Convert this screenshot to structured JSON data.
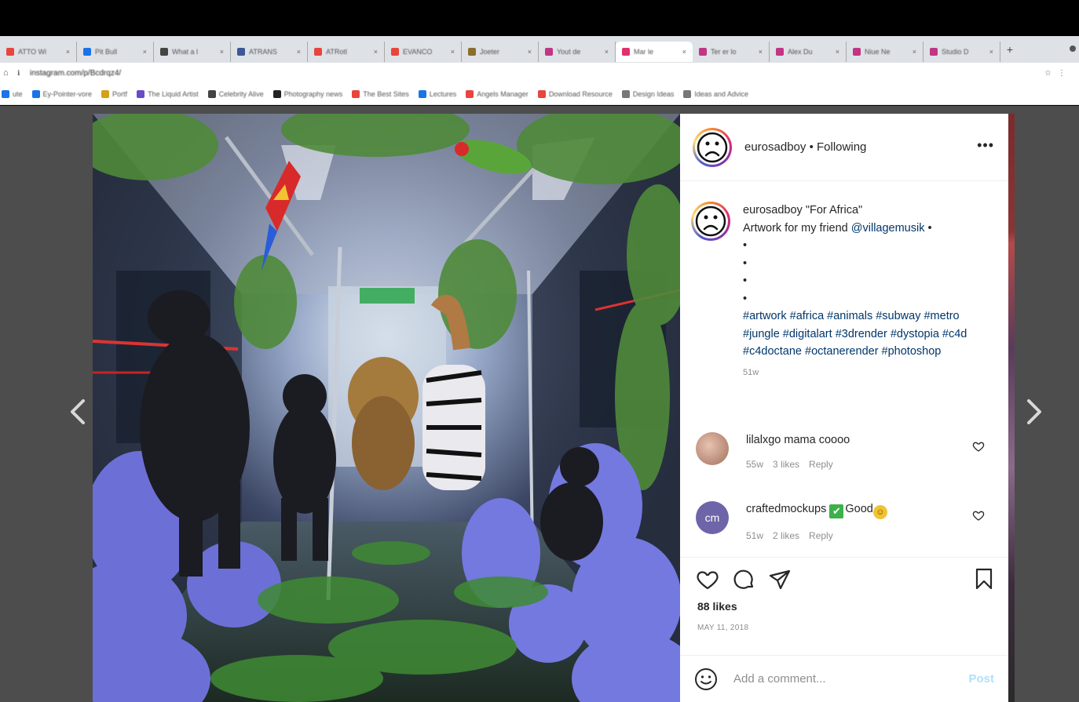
{
  "browser": {
    "tabs": [
      {
        "title": "ATTO Wi",
        "color": "#e8453c"
      },
      {
        "title": "Pit Bull",
        "color": "#1a73e8"
      },
      {
        "title": "What a l",
        "color": "#444444"
      },
      {
        "title": "ATRANS",
        "color": "#3b5998"
      },
      {
        "title": "ATRotl",
        "color": "#e8453c"
      },
      {
        "title": "EVANCO",
        "color": "#e8453c"
      },
      {
        "title": "Joeter",
        "color": "#8b6d2e"
      },
      {
        "title": "Yout de",
        "color": "#c13584"
      },
      {
        "title": "Mar le",
        "color": "#e1306c",
        "active": true
      },
      {
        "title": "Ter er lo",
        "color": "#c13584"
      },
      {
        "title": "Alex Du",
        "color": "#c13584"
      },
      {
        "title": "Niue Ne",
        "color": "#c13584"
      },
      {
        "title": "Studio D",
        "color": "#c13584"
      }
    ],
    "url": "instagram.com/p/Bcdrqz4/",
    "bookmarks": [
      {
        "label": "ute",
        "color": "#1a73e8"
      },
      {
        "label": "Ey-Pointer-vore",
        "color": "#1a73e8"
      },
      {
        "label": "Portf",
        "color": "#d4a017"
      },
      {
        "label": "The Liquid Artist",
        "color": "#6a4bc7"
      },
      {
        "label": "Celebrity Alive",
        "color": "#444444"
      },
      {
        "label": "Photography news",
        "color": "#222222"
      },
      {
        "label": "The Best Sites",
        "color": "#e8453c"
      },
      {
        "label": "Lectures",
        "color": "#1a73e8"
      },
      {
        "label": "Angels Manager",
        "color": "#e8453c"
      },
      {
        "label": "Download Resource",
        "color": "#e8453c"
      },
      {
        "label": "Design Ideas",
        "color": "#777777"
      },
      {
        "label": "Ideas and Advice",
        "color": "#777777"
      }
    ]
  },
  "post": {
    "header": {
      "username": "eurosadboy",
      "separator": "•",
      "follow_status": "Following",
      "more_label": "•••"
    },
    "caption": {
      "username": "eurosadboy",
      "title": "\"For Africa\"",
      "line2_prefix": "Artwork for my friend",
      "mention": "@villagemusik",
      "line2_suffix": "•",
      "dots": [
        "•",
        "•",
        "•",
        "•"
      ],
      "hashtags": "#artwork #africa #animals #subway #metro #jungle #digitalart #3drender #dystopia #c4d #c4doctane #octanerender #photoshop",
      "age": "51w"
    },
    "comments": [
      {
        "username": "lilalxgo",
        "text": "mama coooo",
        "age": "55w",
        "likes": "3 likes",
        "reply": "Reply",
        "avatar_color": "#c9a08c",
        "avatar_text": ""
      },
      {
        "username": "craftedmockups",
        "emoji1": "✔",
        "text": "Good",
        "emoji2": "☺",
        "age": "51w",
        "likes": "2 likes",
        "reply": "Reply",
        "avatar_color": "#6e64a8",
        "avatar_text": "cm"
      }
    ],
    "likes": "88 likes",
    "date": "MAY 11, 2018",
    "add_comment_placeholder": "Add a comment...",
    "post_label": "Post"
  },
  "colors": {
    "link": "#00376b",
    "post_disabled": "#b2dffc",
    "backdrop": "#4d4d4d"
  }
}
